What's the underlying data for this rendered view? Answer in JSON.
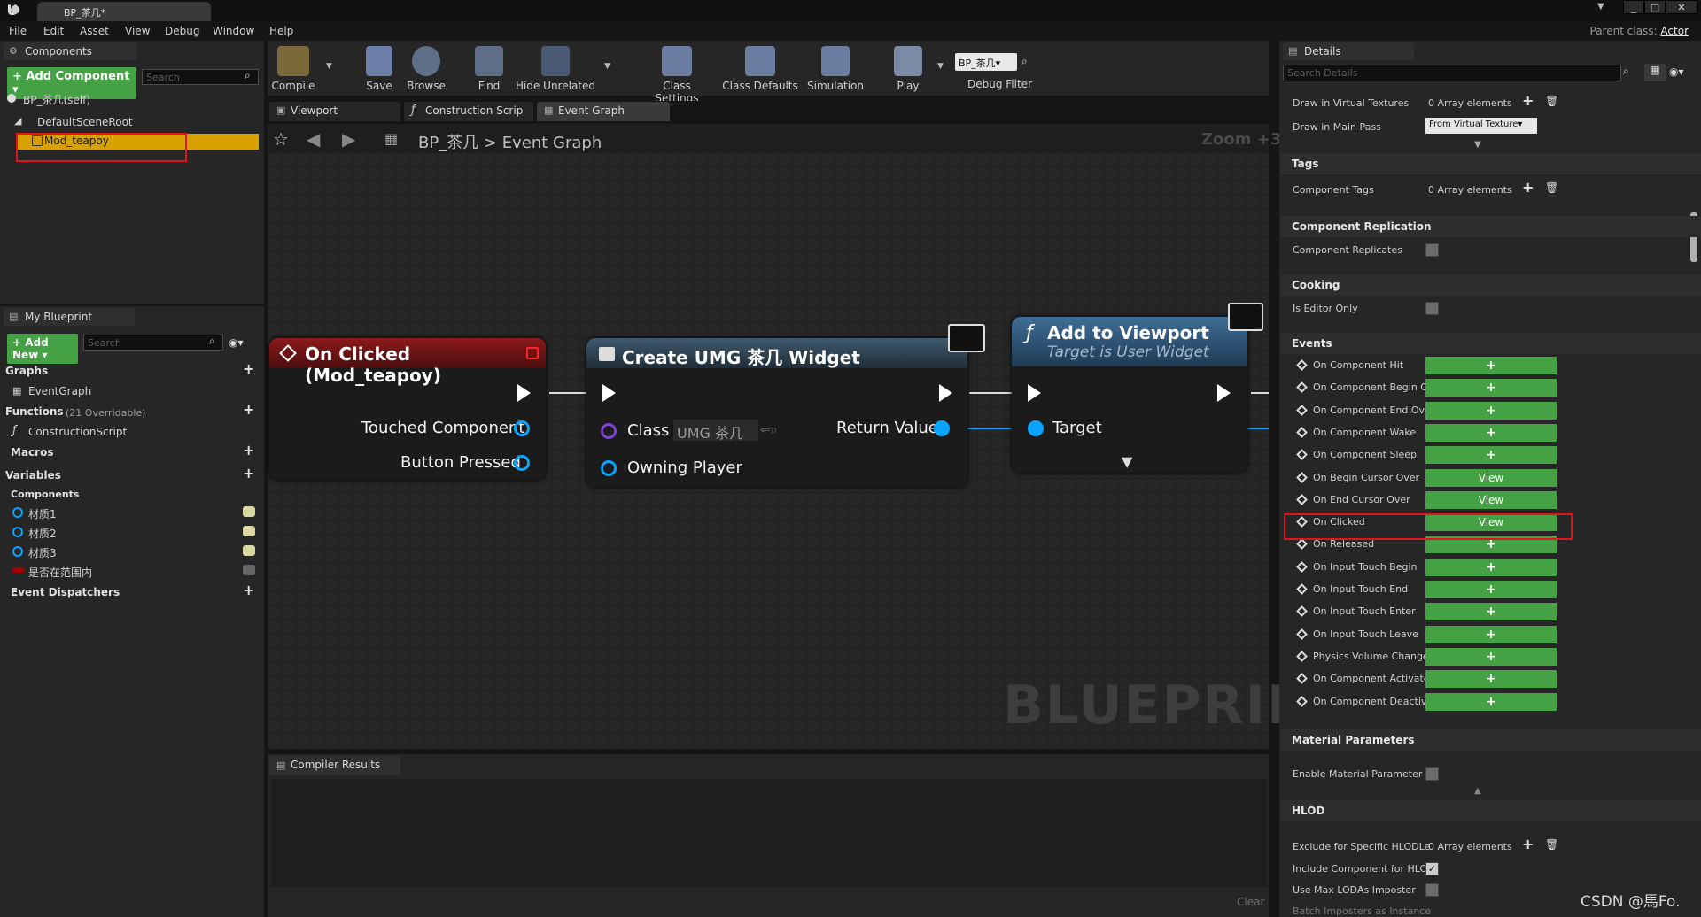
{
  "window": {
    "tab_title": "BP_茶几*",
    "parent_class_label": "Parent class:",
    "parent_class_value": "Actor"
  },
  "menu": [
    "File",
    "Edit",
    "Asset",
    "View",
    "Debug",
    "Window",
    "Help"
  ],
  "components_panel": {
    "title": "Components",
    "add_component": "+ Add Component ▾",
    "search_placeholder": "Search",
    "self_item": "BP_茶几(self)",
    "root": "DefaultSceneRoot",
    "selected": "Mod_teapoy"
  },
  "my_blueprint": {
    "title": "My Blueprint",
    "add_new": "+ Add New ▾",
    "search_placeholder": "Search",
    "graphs_label": "Graphs",
    "event_graph": "EventGraph",
    "functions_label": "Functions",
    "functions_count": "(21 Overridable)",
    "construction_script": "ConstructionScript",
    "macros_label": "Macros",
    "variables_label": "Variables",
    "components_label": "Components",
    "variables": [
      "材质1",
      "材质2",
      "材质3",
      "是否在范围内"
    ],
    "event_dispatchers": "Event Dispatchers"
  },
  "toolbar": {
    "compile": "Compile",
    "save": "Save",
    "browse": "Browse",
    "find": "Find",
    "hide_unrelated": "Hide Unrelated",
    "class_settings": "Class Settings",
    "class_defaults": "Class Defaults",
    "simulation": "Simulation",
    "play": "Play",
    "debug_dropdown": "BP_茶几▾",
    "debug_filter": "Debug Filter"
  },
  "editor_tabs": [
    "Viewport",
    "Construction Scrip",
    "Event Graph"
  ],
  "breadcrumb": {
    "root": "BP_茶几",
    "sep": ">",
    "current": "Event Graph",
    "zoom": "Zoom +3"
  },
  "watermark": "BLUEPRINT",
  "nodes": {
    "on_clicked": {
      "title": "On Clicked (Mod_teapoy)",
      "pins": [
        "Touched Component",
        "Button Pressed"
      ]
    },
    "create_widget": {
      "title": "Create UMG 茶几 Widget",
      "class_label": "Class",
      "class_value": "UMG 茶几",
      "return_value": "Return Value",
      "owning_player": "Owning Player"
    },
    "add_to_viewport": {
      "title": "Add to Viewport",
      "subtitle": "Target is User Widget",
      "target": "Target"
    }
  },
  "compiler": {
    "title": "Compiler Results",
    "clear": "Clear"
  },
  "details": {
    "title": "Details",
    "search_placeholder": "Search Details",
    "draw_in_virtual_textures": "Draw in Virtual Textures",
    "draw_in_main_pass": "Draw in Main Pass",
    "draw_in_main_pass_value": "From Virtual Texture▾",
    "array_elements": "0 Array elements",
    "tags_section": "Tags",
    "component_tags": "Component Tags",
    "replication_section": "Component Replication",
    "component_replicates": "Component Replicates",
    "cooking_section": "Cooking",
    "is_editor_only": "Is Editor Only",
    "events_section": "Events",
    "events": [
      {
        "label": "On Component Hit",
        "action": "+"
      },
      {
        "label": "On Component Begin Ov",
        "action": "+"
      },
      {
        "label": "On Component End Over",
        "action": "+"
      },
      {
        "label": "On Component Wake",
        "action": "+"
      },
      {
        "label": "On Component Sleep",
        "action": "+"
      },
      {
        "label": "On Begin Cursor Over",
        "action": "View"
      },
      {
        "label": "On End Cursor Over",
        "action": "View"
      },
      {
        "label": "On Clicked",
        "action": "View"
      },
      {
        "label": "On Released",
        "action": "+"
      },
      {
        "label": "On Input Touch Begin",
        "action": "+"
      },
      {
        "label": "On Input Touch End",
        "action": "+"
      },
      {
        "label": "On Input Touch Enter",
        "action": "+"
      },
      {
        "label": "On Input Touch Leave",
        "action": "+"
      },
      {
        "label": "Physics Volume Change",
        "action": "+"
      },
      {
        "label": "On Component Activated",
        "action": "+"
      },
      {
        "label": "On Component Deactiva",
        "action": "+"
      }
    ],
    "material_section": "Material Parameters",
    "enable_material_param": "Enable Material Parameter C",
    "hlod_section": "HLOD",
    "exclude_hlod": "Exclude for Specific HLODLe",
    "include_hlod": "Include Component for HLOD",
    "use_max_lod": "Use Max LODAs Imposter",
    "batch_imposters": "Batch Imposters as Instance"
  },
  "csdn_watermark": "CSDN @馬Fo.",
  "colors": {
    "accent_green": "#44a144",
    "highlight_orange": "#d8a100",
    "annotation_red": "#e0141e"
  }
}
